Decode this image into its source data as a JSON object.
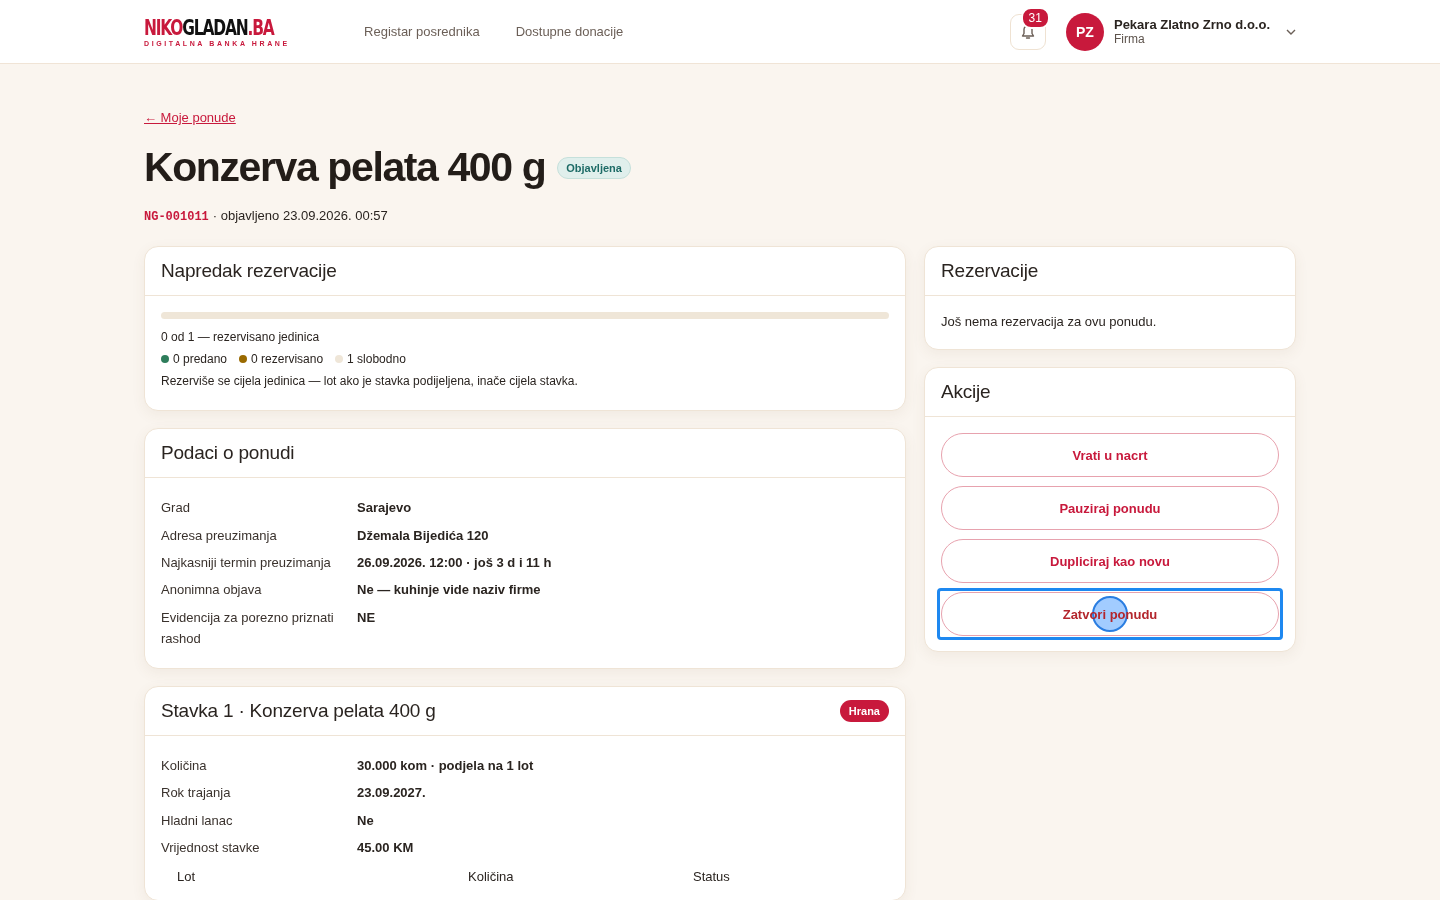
{
  "header": {
    "logo": {
      "parts": [
        {
          "text": "NIKO",
          "kind": "accent"
        },
        {
          "text": "GLADAN",
          "kind": "plain"
        },
        {
          "text": ".BA",
          "kind": "accent"
        }
      ],
      "tagline": "DIGITALNA BANKA HRANE"
    },
    "nav": [
      {
        "label": "Registar posrednika"
      },
      {
        "label": "Dostupne donacije"
      }
    ],
    "notifications": {
      "count": "31"
    },
    "user": {
      "initials": "PZ",
      "name": "Pekara Zlatno Zrno d.o.o.",
      "role": "Firma"
    }
  },
  "back_link": "← Moje ponude",
  "title": "Konzerva pelata 400 g",
  "status_badge": "Objavljena",
  "meta": {
    "code": "NG-001011",
    "published": "· objavljeno 23.09.2026. 00:57"
  },
  "progress_card": {
    "title": "Napredak rezervacije",
    "level": 0,
    "summary": "0 od 1 — rezervisano jedinica",
    "legend": [
      {
        "label": "0 predano",
        "color": "#2e7d5b"
      },
      {
        "label": "0 rezervisano",
        "color": "#9a6a00"
      },
      {
        "label": "1 slobodno",
        "color": "#efe6d8"
      }
    ],
    "note": "Rezerviše se cijela jedinica — lot ako je stavka podijeljena, inače cijela stavka."
  },
  "details_card": {
    "title": "Podaci o ponudi",
    "rows": [
      {
        "label": "Grad",
        "value": "Sarajevo"
      },
      {
        "label": "Adresa preuzimanja",
        "value": "Džemala Bijedića 120"
      },
      {
        "label": "Najkasniji termin preuzimanja",
        "value": "26.09.2026. 12:00 · još 3 d i 11 h"
      },
      {
        "label": "Anonimna objava",
        "value": "Ne — kuhinje vide naziv firme"
      },
      {
        "label": "Evidencija za porezno priznati rashod",
        "value": "NE"
      }
    ]
  },
  "item_card": {
    "title": "Stavka 1 · Konzerva pelata 400 g",
    "tag": "Hrana",
    "rows": [
      {
        "label": "Količina",
        "value": "30.000 kom · podjela na 1 lot"
      },
      {
        "label": "Rok trajanja",
        "value": "23.09.2027."
      },
      {
        "label": "Hladni lanac",
        "value": "Ne"
      },
      {
        "label": "Vrijednost stavke",
        "value": "45.00 KM"
      }
    ],
    "lot_table": {
      "columns": [
        "Lot",
        "Količina",
        "Status"
      ]
    }
  },
  "reservations_card": {
    "title": "Rezervacije",
    "empty_text": "Još nema rezervacija za ovu ponudu."
  },
  "actions_card": {
    "title": "Akcije",
    "buttons": [
      {
        "label": "Vrati u nacrt",
        "focused": false
      },
      {
        "label": "Pauziraj ponudu",
        "focused": false
      },
      {
        "label": "Dupliciraj kao novu",
        "focused": false
      },
      {
        "label": "Zatvori ponudu",
        "focused": true
      }
    ]
  }
}
